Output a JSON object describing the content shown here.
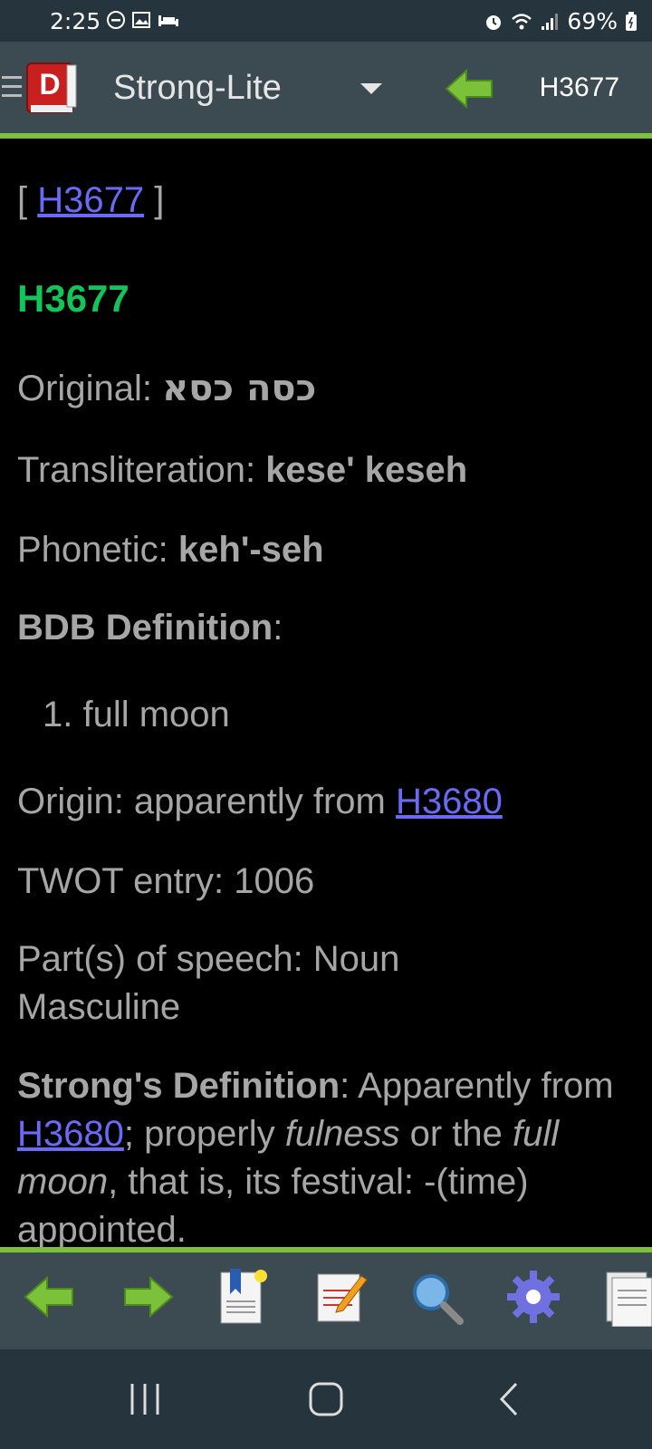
{
  "status": {
    "time": "2:25",
    "battery": "69%",
    "icons": [
      "do-not-disturb-icon",
      "gallery-icon",
      "sleep-icon",
      "alarm-icon",
      "wifi-icon",
      "signal-icon",
      "battery-icon"
    ]
  },
  "appbar": {
    "title": "Strong-Lite",
    "reference": "H3677"
  },
  "content": {
    "topic_open": "[ ",
    "topic_link": "H3677",
    "topic_close": " ]",
    "heading": "H3677",
    "original_label": "Original: ",
    "original_value": "כסה כסא",
    "translit_label": "Transliteration: ",
    "translit_value": "kese' keseh",
    "phonetic_label": "Phonetic: ",
    "phonetic_value": "keh'-seh",
    "bdb_label": "BDB Definition",
    "bdb_colon": ":",
    "bdb_item": "1. full moon",
    "origin_label": "Origin: apparently from ",
    "origin_link": "H3680",
    "twot": "TWOT entry: 1006",
    "pos": "Part(s) of speech: Noun Masculine",
    "strongs_label": "Strong's Definition",
    "strongs_text_1": ": Apparently from ",
    "strongs_link": "H3680",
    "strongs_text_2": "; properly ",
    "strongs_em_1": "fulness",
    "strongs_text_3": " or the ",
    "strongs_em_2": "full moon",
    "strongs_text_4": ", that is, its festival: -(time) appointed."
  },
  "colors": {
    "appbar": "#3c4a52",
    "accent_green": "#7cc13a",
    "heading_green": "#12c45a",
    "link": "#6a6af5",
    "text": "#a6a6a6"
  }
}
